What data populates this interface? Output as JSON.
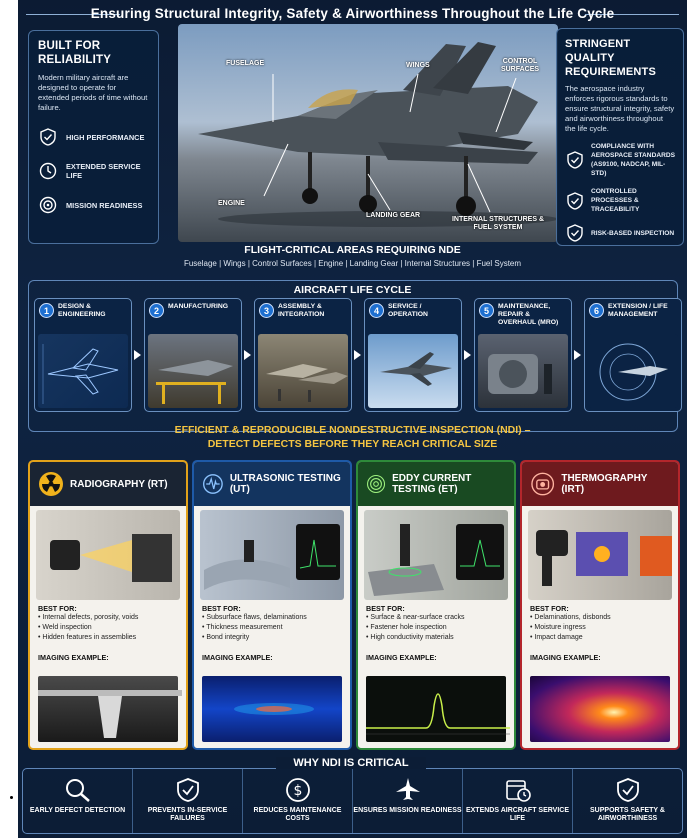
{
  "title": "Ensuring Structural Integrity, Safety & Airworthiness Throughout the Life Cycle",
  "left_panel": {
    "heading": "BUILT FOR RELIABILITY",
    "text": "Modern military aircraft are designed to operate for extended periods of time without failure.",
    "features": [
      {
        "icon": "shield-check-icon",
        "label": "HIGH PERFORMANCE"
      },
      {
        "icon": "clock-icon",
        "label": "EXTENDED SERVICE LIFE"
      },
      {
        "icon": "target-icon",
        "label": "MISSION READINESS"
      }
    ]
  },
  "right_panel": {
    "heading": "STRINGENT QUALITY REQUIREMENTS",
    "text": "The aerospace industry enforces rigorous standards to ensure structural integrity, safety and airworthiness throughout the life cycle.",
    "features": [
      {
        "icon": "shield-check-icon",
        "label": "COMPLIANCE WITH AEROSPACE STANDARDS (AS9100, NADCAP, MIL-STD)"
      },
      {
        "icon": "shield-check-icon",
        "label": "CONTROLLED PROCESSES & TRACEABILITY"
      },
      {
        "icon": "shield-check-icon",
        "label": "RISK-BASED INSPECTION"
      }
    ]
  },
  "jet_labels": {
    "fuselage": "FUSELAGE",
    "wings": "WINGS",
    "control": "CONTROL SURFACES",
    "engine": "ENGINE",
    "landing": "LANDING GEAR",
    "internal": "INTERNAL STRUCTURES & FUEL SYSTEM"
  },
  "critical": {
    "title": "FLIGHT-CRITICAL AREAS REQUIRING NDE",
    "list": "Fuselage  |  Wings  |  Control Surfaces  |  Engine  |  Landing Gear  |  Internal Structures  |  Fuel System"
  },
  "lifecycle": {
    "title": "AIRCRAFT LIFE CYCLE",
    "stages": [
      {
        "num": "1",
        "name": "DESIGN & ENGINEERING"
      },
      {
        "num": "2",
        "name": "MANUFACTURING"
      },
      {
        "num": "3",
        "name": "ASSEMBLY & INTEGRATION"
      },
      {
        "num": "4",
        "name": "SERVICE / OPERATION"
      },
      {
        "num": "5",
        "name": "MAINTENANCE, REPAIR & OVERHAUL (MRO)"
      },
      {
        "num": "6",
        "name": "EXTENSION / LIFE MANAGEMENT"
      }
    ]
  },
  "ndi": {
    "line1": "EFFICIENT & REPRODUCIBLE NONDESTRUCTIVE INSPECTION (NDI) –",
    "line2": "DETECT DEFECTS BEFORE THEY REACH CRITICAL SIZE"
  },
  "methods": [
    {
      "name": "RADIOGRAPHY (RT)",
      "color": "#e2a21a",
      "icon": "radiation-icon",
      "best_label": "BEST FOR:",
      "best": [
        "• Internal defects, porosity, voids",
        "• Weld inspection",
        "• Hidden features in assemblies"
      ],
      "example_label": "IMAGING EXAMPLE:"
    },
    {
      "name": "ULTRASONIC TESTING (UT)",
      "color": "#1e5aa8",
      "icon": "waveform-icon",
      "best_label": "BEST FOR:",
      "best": [
        "• Subsurface flaws, delaminations",
        "• Thickness measurement",
        "• Bond integrity"
      ],
      "example_label": "IMAGING EXAMPLE:"
    },
    {
      "name": "EDDY CURRENT TESTING (ET)",
      "color": "#2e8a3a",
      "icon": "coil-icon",
      "best_label": "BEST FOR:",
      "best": [
        "• Surface & near-surface cracks",
        "• Fastener hole inspection",
        "• High conductivity materials"
      ],
      "example_label": "IMAGING EXAMPLE:"
    },
    {
      "name": "THERMOGRAPHY (IRT)",
      "color": "#b3262c",
      "icon": "thermal-camera-icon",
      "best_label": "BEST FOR:",
      "best": [
        "• Delaminations, disbonds",
        "• Moisture ingress",
        "• Impact damage"
      ],
      "example_label": "IMAGING EXAMPLE:"
    }
  ],
  "why": {
    "title": "WHY NDI IS CRITICAL",
    "items": [
      {
        "icon": "magnifier-icon",
        "label": "EARLY DEFECT DETECTION"
      },
      {
        "icon": "shield-check-icon",
        "label": "PREVENTS IN-SERVICE FAILURES"
      },
      {
        "icon": "dollar-icon",
        "label": "REDUCES MAINTENANCE COSTS"
      },
      {
        "icon": "jet-icon",
        "label": "ENSURES MISSION READINESS"
      },
      {
        "icon": "calendar-clock-icon",
        "label": "EXTENDS AIRCRAFT SERVICE LIFE"
      },
      {
        "icon": "shield-check-icon",
        "label": "SUPPORTS SAFETY & AIRWORTHINESS"
      }
    ]
  }
}
